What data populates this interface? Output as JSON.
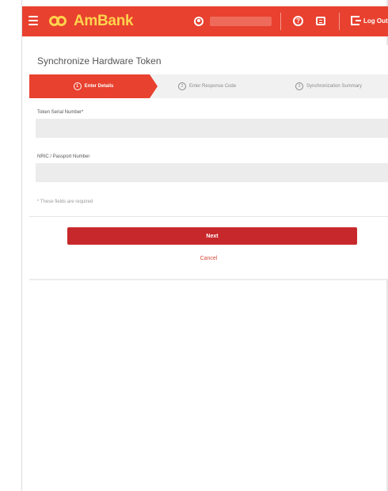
{
  "header": {
    "brand": "AmBank",
    "logout_label": "Log Out"
  },
  "page": {
    "title": "Synchronize Hardware Token"
  },
  "stepper": {
    "steps": [
      {
        "num": "1",
        "label": "Enter Details"
      },
      {
        "num": "2",
        "label": "Enter Response Code"
      },
      {
        "num": "3",
        "label": "Synchronization Summary"
      }
    ]
  },
  "form": {
    "token_label": "Token Serial Number*",
    "token_value": "",
    "nric_label": "NRIC / Passport Number",
    "nric_value": "",
    "required_note": "* These fields are required"
  },
  "actions": {
    "next_label": "Next",
    "cancel_label": "Cancel"
  },
  "colors": {
    "brand_red": "#e8412f",
    "logo_yellow": "#ffd34d",
    "button_red": "#c7282b"
  },
  "icons": [
    "menu-icon",
    "user-icon",
    "help-icon",
    "message-icon",
    "logout-icon"
  ]
}
